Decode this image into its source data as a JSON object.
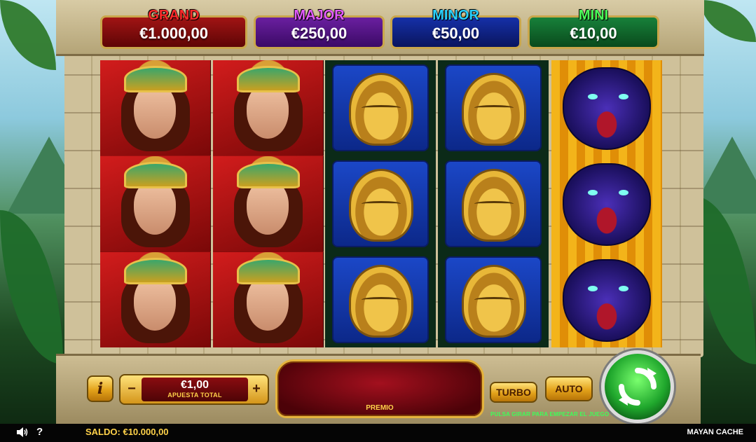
{
  "jackpots": {
    "grand": {
      "label": "GRAND",
      "amount": "€1.000,00"
    },
    "major": {
      "label": "MAJOR",
      "amount": "€250,00"
    },
    "minor": {
      "label": "MINOR",
      "amount": "€50,00"
    },
    "mini": {
      "label": "MINI",
      "amount": "€10,00"
    }
  },
  "reels": [
    [
      "queen",
      "queen",
      "queen"
    ],
    [
      "queen",
      "queen",
      "queen"
    ],
    [
      "mask",
      "mask",
      "mask"
    ],
    [
      "mask",
      "mask",
      "mask"
    ],
    [
      "panther",
      "panther",
      "panther"
    ]
  ],
  "controls": {
    "info_label": "i",
    "bet_value": "€1,00",
    "bet_label": "APUESTA TOTAL",
    "minus_label": "−",
    "plus_label": "+",
    "premio_label": "PREMIO",
    "turbo_label": "TURBO",
    "auto_label": "AUTO",
    "hint": "PULSA GIRAR PARA EMPEZAR EL JUEGO"
  },
  "status": {
    "help_label": "?",
    "saldo_label": "SALDO:",
    "saldo_value": "€10.000,00",
    "game_title": "MAYAN CACHE"
  },
  "colors": {
    "grand": "#ff2a2a",
    "major": "#e45cff",
    "minor": "#2bd2ff",
    "mini": "#4bff5a",
    "accent_gold": "#ffd24a",
    "spin_green": "#1fa62c"
  }
}
